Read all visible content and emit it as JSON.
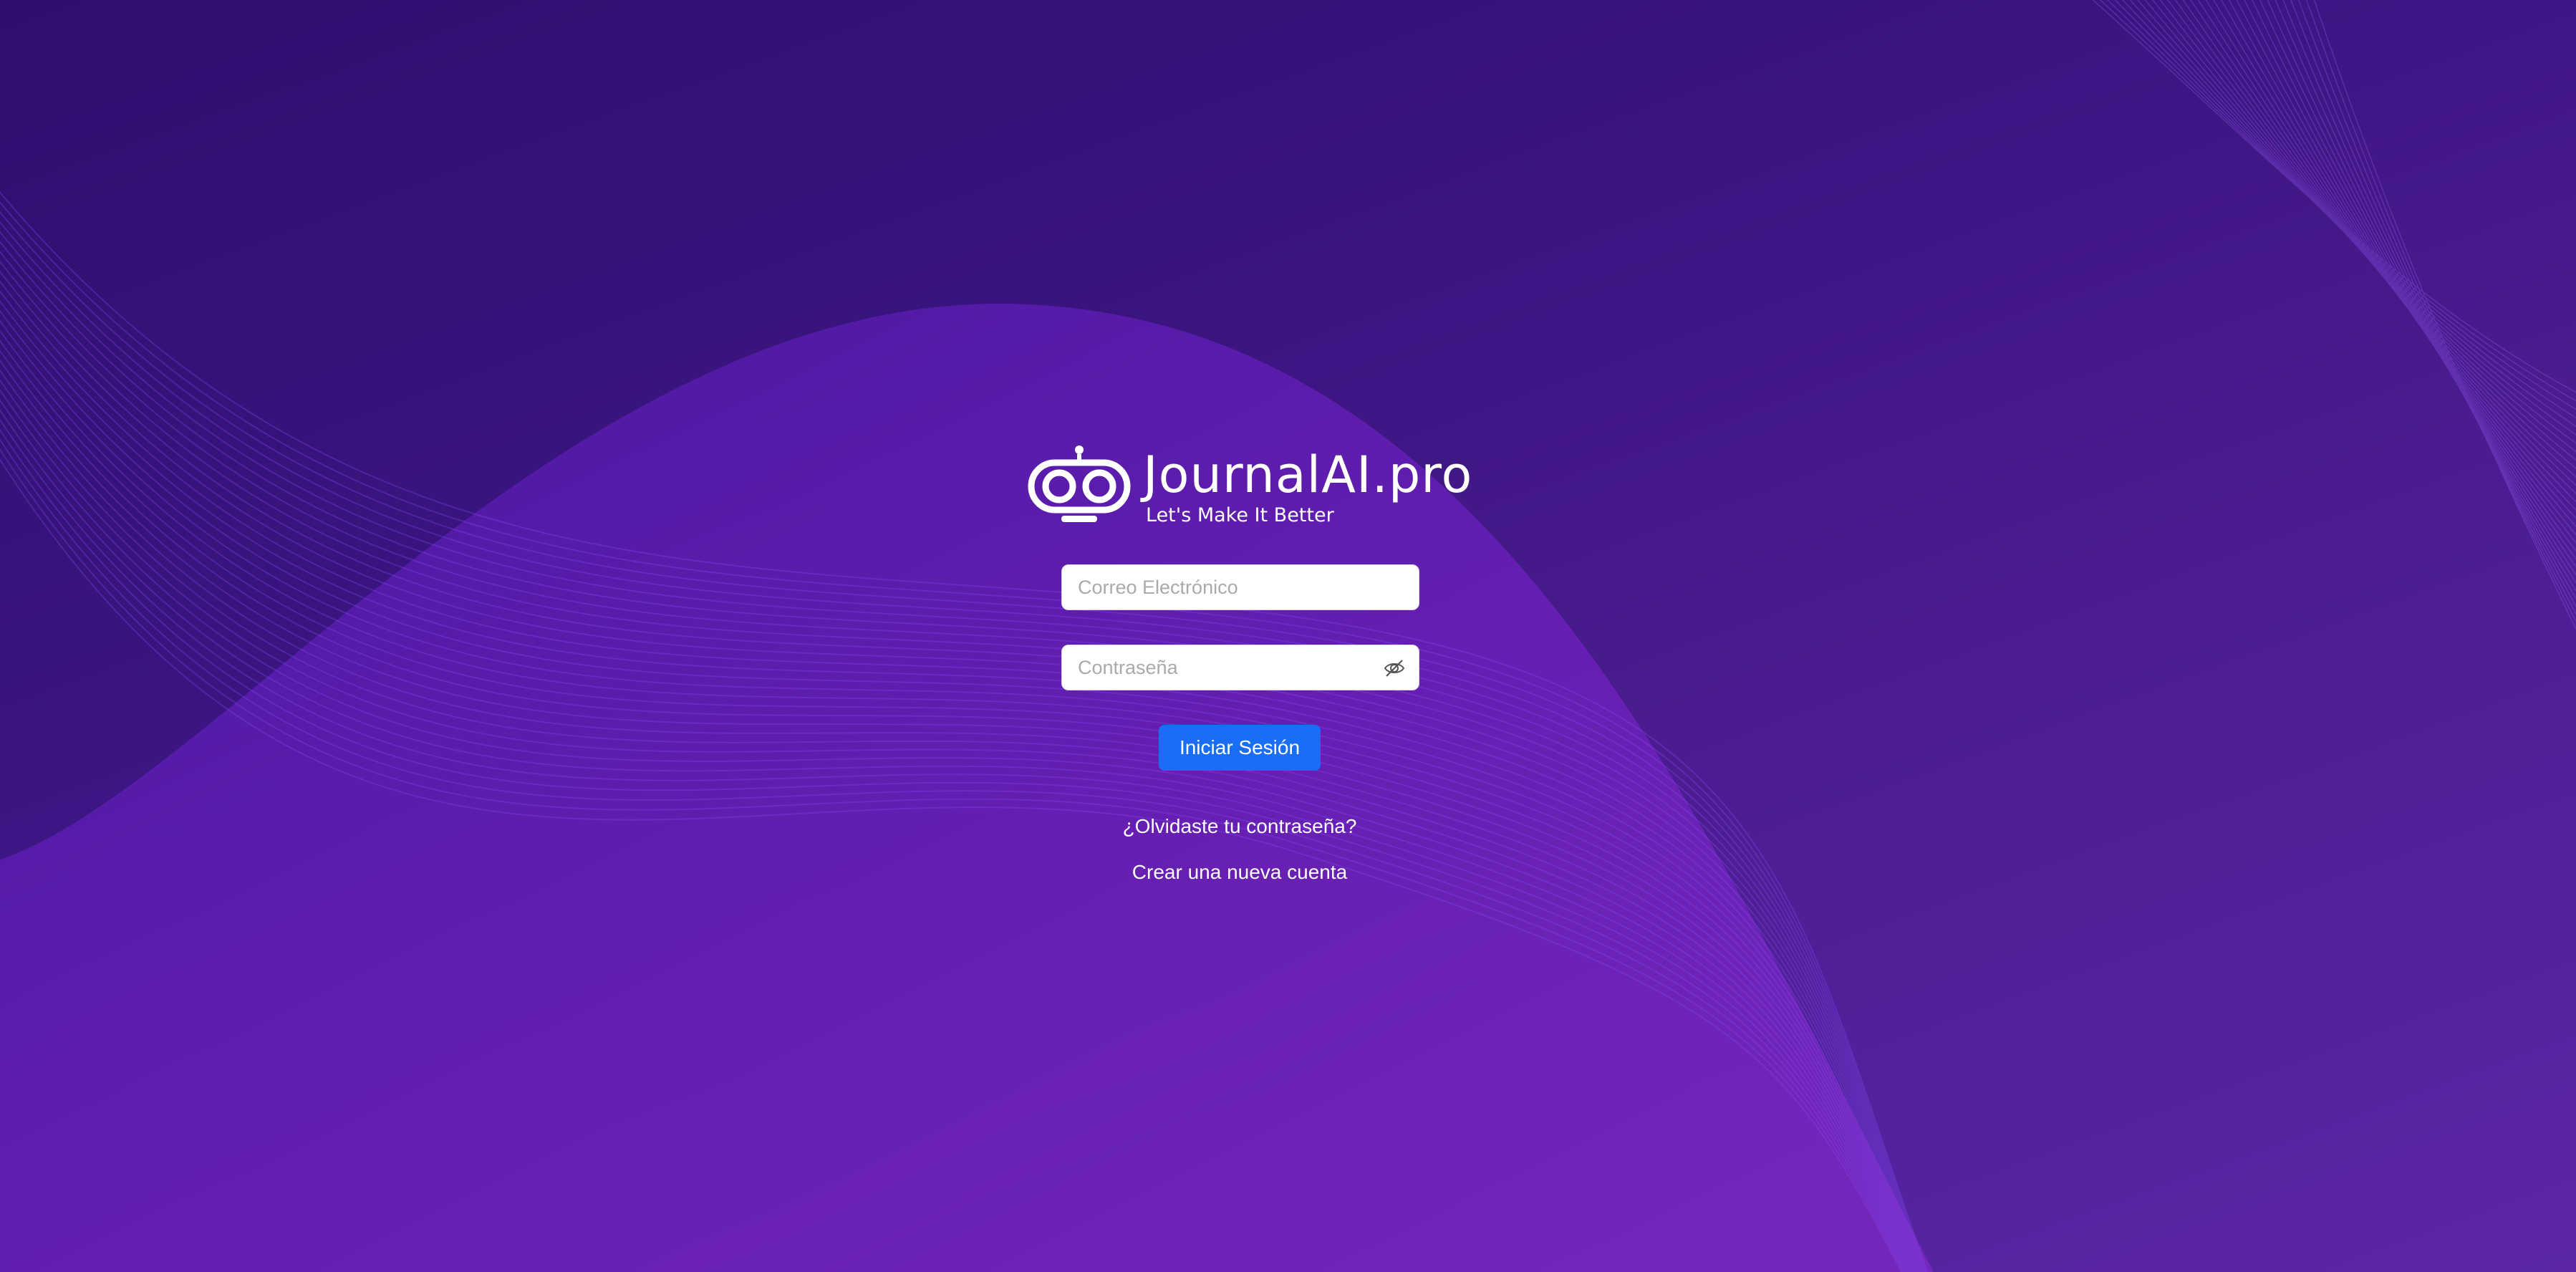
{
  "brand": {
    "name": "JournalAI.pro",
    "tagline": "Let's Make It Better"
  },
  "login_form": {
    "email_placeholder": "Correo Electrónico",
    "email_value": "",
    "password_placeholder": "Contraseña",
    "password_value": "",
    "submit_label": "Iniciar Sesión"
  },
  "links": {
    "forgot_password": "¿Olvidaste tu contraseña?",
    "create_account": "Crear una nueva cuenta"
  },
  "icons": {
    "logo": "robot-eyes-logo-icon",
    "password_toggle": "eye-slash-icon"
  },
  "colors": {
    "background_dark": "#2e0f6e",
    "background_light": "#5b26a8",
    "button": "#1a6ef5",
    "text": "#ffffff"
  }
}
